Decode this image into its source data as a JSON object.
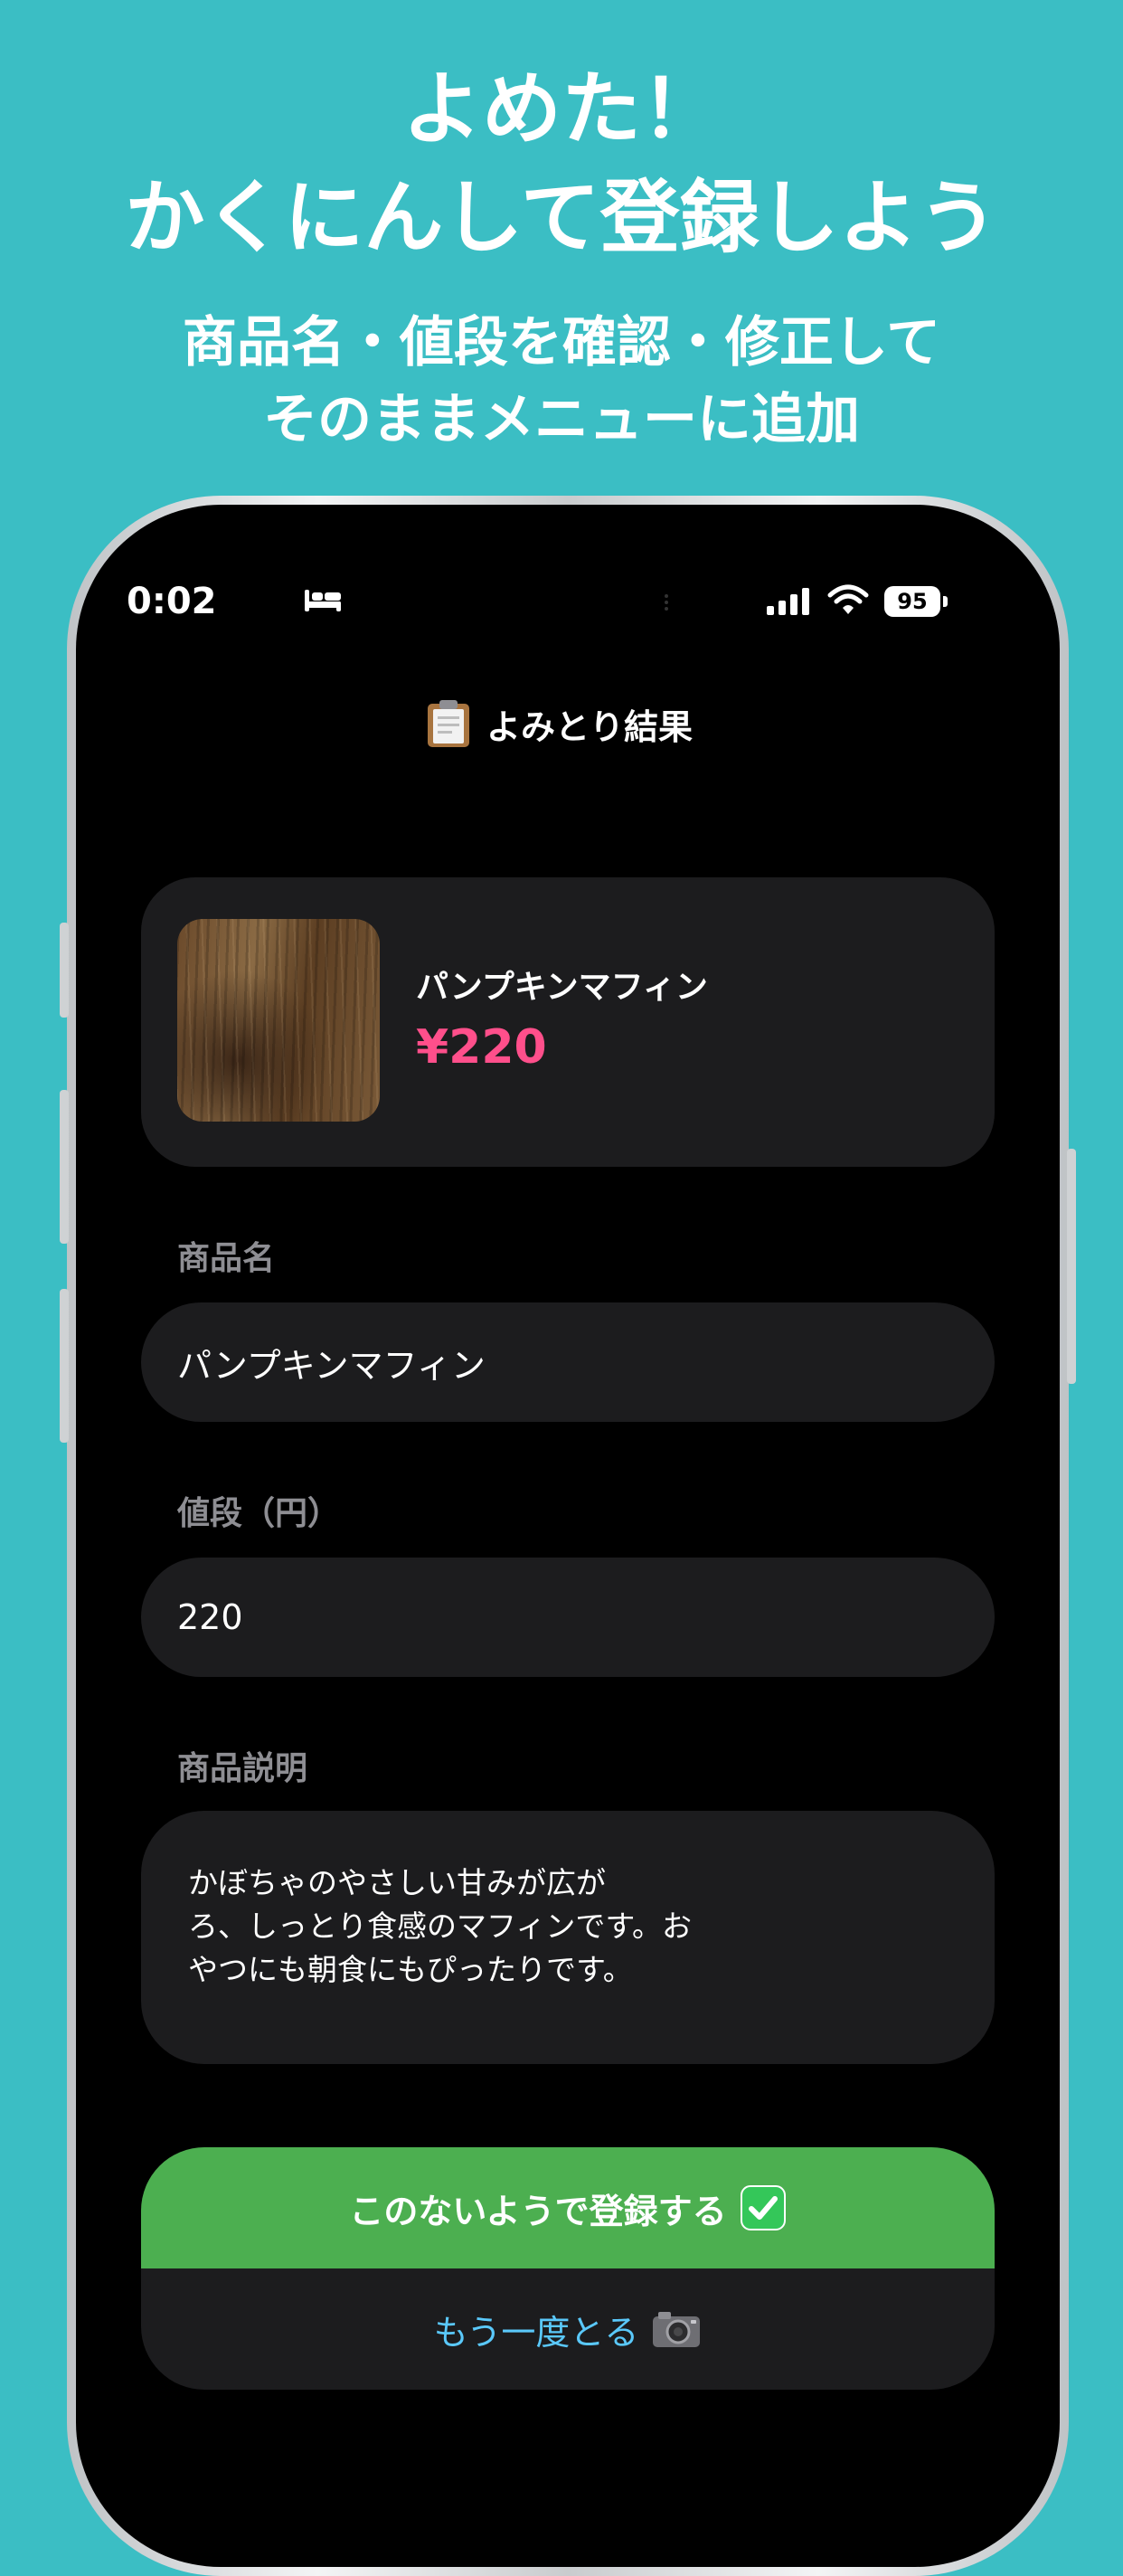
{
  "promo": {
    "headline_line1": "よめた！",
    "headline_line2": "かくにんして登録しよう",
    "sub_line1": "商品名・値段を確認・修正して",
    "sub_line2": "そのままメニューに追加"
  },
  "status_bar": {
    "time": "0:02",
    "battery": "95",
    "icons": [
      "bed-icon",
      "signal-icon",
      "wifi-icon",
      "battery-icon"
    ]
  },
  "screen": {
    "title_icon": "clipboard-icon",
    "title": "よみとり結果"
  },
  "result_card": {
    "name": "パンプキンマフィン",
    "price": "¥220",
    "price_color": "#FF4F8B"
  },
  "form": {
    "name_label": "商品名",
    "name_value": "パンプキンマフィン",
    "price_label": "値段（円）",
    "price_value": "220",
    "desc_label": "商品説明",
    "desc_lines": [
      "かぼちゃのやさしい甘みが広が",
      "ろ、しっとり食感のマフィンです。お",
      "やつにも朝食にもぴったりです。"
    ]
  },
  "actions": {
    "register_label": "このないようで登録する",
    "register_icon": "check-icon",
    "register_color": "#4CAF50",
    "retake_label": "もう一度とる",
    "retake_icon": "camera-icon",
    "retake_color": "#5AC8FA"
  }
}
